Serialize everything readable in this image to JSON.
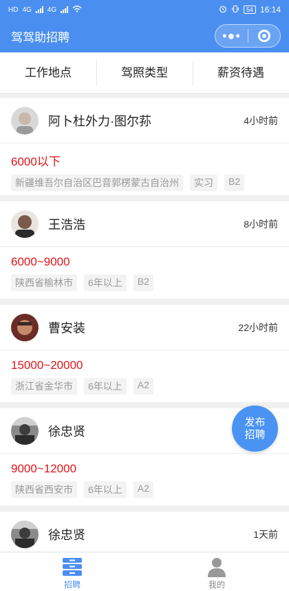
{
  "status_bar": {
    "left_labels": [
      "HD",
      "4G",
      "4G"
    ],
    "alarm_icon": "alarm-icon",
    "vibrate_icon": "vibrate-icon",
    "battery": "54",
    "time": "16:14"
  },
  "header": {
    "title": "驾驾助招聘",
    "menu_icon": "more-dots-icon",
    "close_icon": "close-circle-icon"
  },
  "filters": [
    "工作地点",
    "驾照类型",
    "薪资待遇"
  ],
  "jobs": [
    {
      "name": "阿卜杜外力·图尔荪",
      "time": "4小时前",
      "salary": "6000以下",
      "tags": [
        "新疆维吾尔自治区巴音郭楞蒙古自治州",
        "实习",
        "B2"
      ]
    },
    {
      "name": "王浩浩",
      "time": "8小时前",
      "salary": "6000~9000",
      "tags": [
        "陕西省榆林市",
        "6年以上",
        "B2"
      ]
    },
    {
      "name": "曹安装",
      "time": "22小时前",
      "salary": "15000~20000",
      "tags": [
        "浙江省金华市",
        "6年以上",
        "A2"
      ]
    },
    {
      "name": "徐忠贤",
      "time": "",
      "salary": "9000~12000",
      "tags": [
        "陕西省西安市",
        "6年以上",
        "A2"
      ]
    },
    {
      "name": "徐忠贤",
      "time": "1天前",
      "salary": "",
      "tags": []
    }
  ],
  "fab": {
    "line1": "发布",
    "line2": "招聘"
  },
  "tabbar": {
    "tabs": [
      {
        "label": "招聘",
        "icon": "drawer-icon",
        "active": true
      },
      {
        "label": "我的",
        "icon": "user-icon",
        "active": false
      }
    ]
  },
  "colors": {
    "primary": "#4a8ff0",
    "salary": "#e0151b"
  }
}
